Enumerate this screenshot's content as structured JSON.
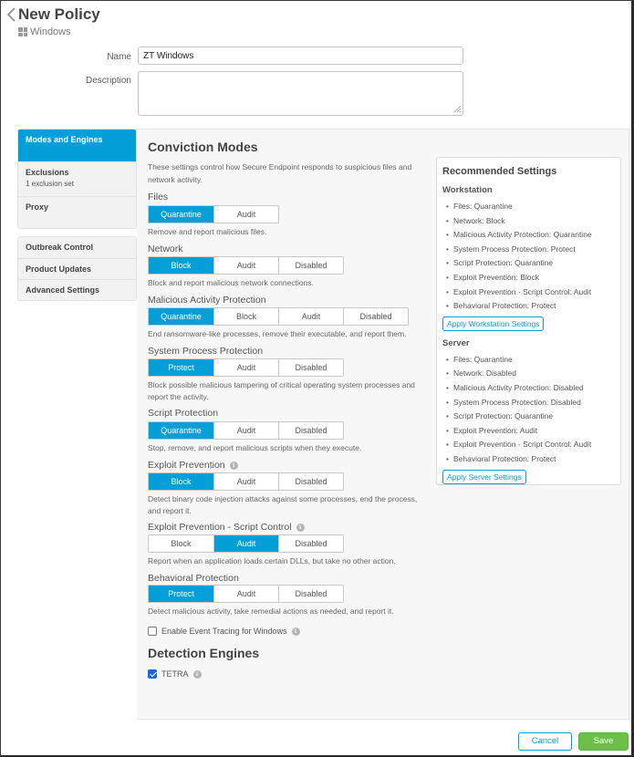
{
  "header": {
    "title": "New Policy",
    "platform": "Windows",
    "platform_icon": "windows-logo-icon",
    "back_icon": "chevron-left-icon"
  },
  "form": {
    "name_label": "Name",
    "name_value": "ZT Windows",
    "description_label": "Description",
    "description_value": ""
  },
  "sidebar": {
    "group1": [
      {
        "label": "Modes and Engines",
        "active": true
      },
      {
        "label": "Exclusions",
        "sub": "1 exclusion set"
      },
      {
        "label": "Proxy"
      }
    ],
    "group2": [
      {
        "label": "Outbreak Control"
      },
      {
        "label": "Product Updates"
      },
      {
        "label": "Advanced Settings"
      }
    ]
  },
  "conviction": {
    "title": "Conviction Modes",
    "intro": "These settings control how Secure Endpoint responds to suspicious files and network activity.",
    "fields": [
      {
        "label": "Files",
        "options": [
          "Quarantine",
          "Audit"
        ],
        "selected": "Quarantine",
        "help": "Remove and report malicious files.",
        "info": false
      },
      {
        "label": "Network",
        "options": [
          "Block",
          "Audit",
          "Disabled"
        ],
        "selected": "Block",
        "help": "Block and report malicious network connections.",
        "info": false
      },
      {
        "label": "Malicious Activity Protection",
        "options": [
          "Quarantine",
          "Block",
          "Audit",
          "Disabled"
        ],
        "selected": "Quarantine",
        "help": "End ransomware-like processes, remove their executable, and report them.",
        "info": false
      },
      {
        "label": "System Process Protection",
        "options": [
          "Protect",
          "Audit",
          "Disabled"
        ],
        "selected": "Protect",
        "help": "Block possible malicious tampering of critical operating system processes and report the activity.",
        "info": false
      },
      {
        "label": "Script Protection",
        "options": [
          "Quarantine",
          "Audit",
          "Disabled"
        ],
        "selected": "Quarantine",
        "help": "Stop, remove, and report malicious scripts when they execute.",
        "info": false
      },
      {
        "label": "Exploit Prevention",
        "options": [
          "Block",
          "Audit",
          "Disabled"
        ],
        "selected": "Block",
        "help": "Detect binary code injection attacks against some processes, end the process, and report it.",
        "info": true
      },
      {
        "label": "Exploit Prevention - Script Control",
        "options": [
          "Block",
          "Audit",
          "Disabled"
        ],
        "selected": "Audit",
        "help": "Report when an application loads certain DLLs, but take no other action.",
        "info": true
      },
      {
        "label": "Behavioral Protection",
        "options": [
          "Protect",
          "Audit",
          "Disabled"
        ],
        "selected": "Protect",
        "help": "Detect malicious activity, take remedial actions as needed, and report it.",
        "info": false
      }
    ],
    "event_tracing": {
      "label": "Enable Event Tracing for Windows",
      "checked": false
    }
  },
  "detection": {
    "title": "Detection Engines",
    "tetra": {
      "label": "TETRA",
      "checked": true
    }
  },
  "recommended": {
    "title": "Recommended Settings",
    "workstation": {
      "title": "Workstation",
      "items": [
        "Files: Quarantine",
        "Network: Block",
        "Malicious Activity Protection: Quarantine",
        "System Process Protection: Protect",
        "Script Protection: Quarantine",
        "Exploit Prevention: Block",
        "Exploit Prevention - Script Control: Audit",
        "Behavioral Protection: Protect"
      ],
      "button": "Apply Workstation Settings"
    },
    "server": {
      "title": "Server",
      "items": [
        "Files: Quarantine",
        "Network: Disabled",
        "Malicious Activity Protection: Disabled",
        "System Process Protection: Disabled",
        "Script Protection: Quarantine",
        "Exploit Prevention: Audit",
        "Exploit Prevention - Script Control: Audit",
        "Behavioral Protection: Protect"
      ],
      "button": "Apply Server Settings"
    }
  },
  "footer": {
    "cancel": "Cancel",
    "save": "Save"
  },
  "colors": {
    "accent": "#049fd9",
    "save": "#6cc04a",
    "checkbox": "#1a66d8"
  }
}
